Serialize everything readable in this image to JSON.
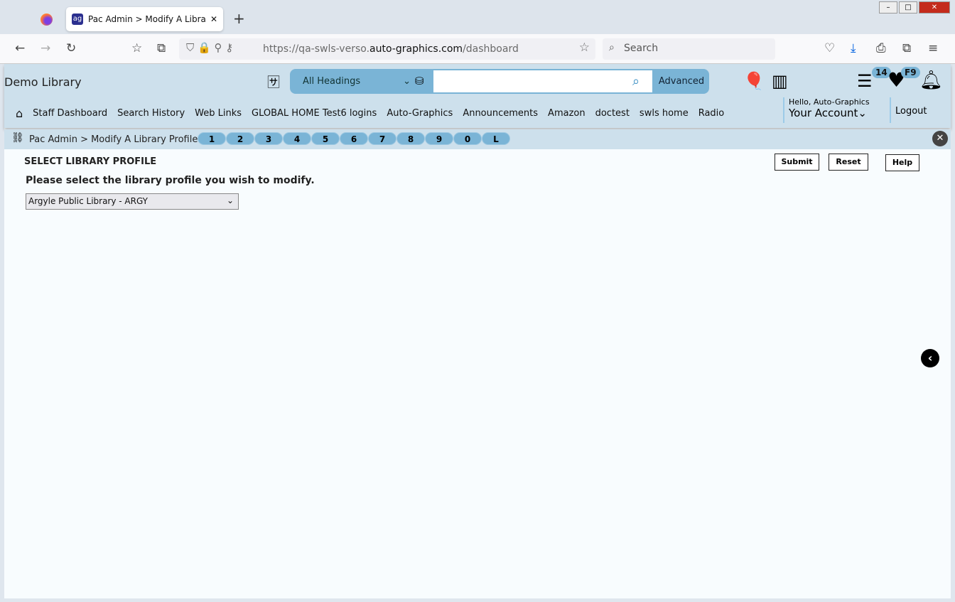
{
  "browser": {
    "tab_title": "Pac Admin > Modify A Library Profile",
    "url_prefix": "https://qa-swls-verso.",
    "url_domain": "auto-graphics.com",
    "url_path": "/dashboard",
    "search_placeholder": "Search"
  },
  "header": {
    "library_name": "Demo Library",
    "search_scope": "All Headings",
    "search_value": "",
    "advanced_label": "Advanced",
    "list_count": "14",
    "favorites_badge": "F9",
    "greeting": "Hello, Auto-Graphics",
    "account_label": "Your Account",
    "logout_label": "Logout"
  },
  "menu": [
    "Staff Dashboard",
    "Search History",
    "Web Links",
    "GLOBAL HOME Test6 logins",
    "Auto-Graphics",
    "Announcements",
    "Amazon",
    "doctest",
    "swls home",
    "Radio"
  ],
  "breadcrumb": "Pac Admin > Modify A Library Profile",
  "quick_keys": [
    "1",
    "2",
    "3",
    "4",
    "5",
    "6",
    "7",
    "8",
    "9",
    "0",
    "L"
  ],
  "main": {
    "section_title": "SELECT LIBRARY PROFILE",
    "prompt": "Please select the library profile you wish to modify.",
    "selected_library": "Argyle Public Library - ARGY",
    "submit": "Submit",
    "reset": "Reset",
    "help": "Help"
  }
}
